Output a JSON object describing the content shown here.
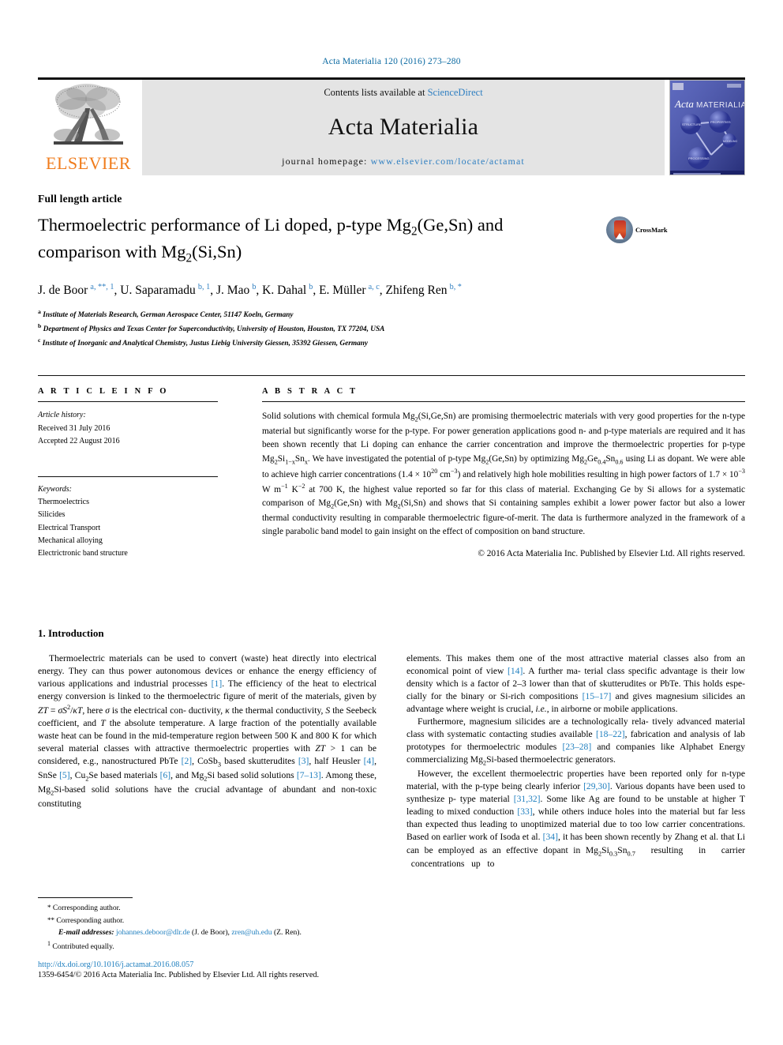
{
  "running_head": "Acta Materialia 120 (2016) 273–280",
  "masthead": {
    "publisher": "ELSEVIER",
    "contents_prefix": "Contents lists available at ",
    "contents_link": "ScienceDirect",
    "journal_name": "Acta Materialia",
    "homepage_label": "journal homepage: ",
    "homepage_url": "www.elsevier.com/locate/actamat",
    "cover_title_a": "Acta",
    "cover_title_b": "MATERIALIA",
    "cover_nodes": [
      "STRUCTURE",
      "PROPERTIES",
      "MODELING",
      "PROCESSING"
    ]
  },
  "article": {
    "type": "Full length article",
    "title_line1": "Thermoelectric performance of Li doped, p-type Mg",
    "title_sub1": "2",
    "title_line1b": "(Ge,Sn) and",
    "title_line2": "comparison with Mg",
    "title_sub2": "2",
    "title_line2b": "(Si,Sn)",
    "crossmark_label": "CrossMark"
  },
  "authors": [
    {
      "name": "J. de Boor",
      "sup": "a, **, 1"
    },
    {
      "name": "U. Saparamadu",
      "sup": "b, 1"
    },
    {
      "name": "J. Mao",
      "sup": "b"
    },
    {
      "name": "K. Dahal",
      "sup": "b"
    },
    {
      "name": "E. Müller",
      "sup": "a, c"
    },
    {
      "name": "Zhifeng Ren",
      "sup": "b, *"
    }
  ],
  "affiliations": [
    {
      "mark": "a",
      "text": "Institute of Materials Research, German Aerospace Center, 51147 Koeln, Germany"
    },
    {
      "mark": "b",
      "text": "Department of Physics and Texas Center for Superconductivity, University of Houston, Houston, TX 77204, USA"
    },
    {
      "mark": "c",
      "text": "Institute of Inorganic and Analytical Chemistry, Justus Liebig University Giessen, 35392 Giessen, Germany"
    }
  ],
  "article_info": {
    "heading": "A R T I C L E   I N F O",
    "history_label": "Article history:",
    "received": "Received 31 July 2016",
    "accepted": "Accepted 22 August 2016",
    "keywords_label": "Keywords:",
    "keywords": [
      "Thermoelectrics",
      "Silicides",
      "Electrical Transport",
      "Mechanical alloying",
      "Electrictronic band structure"
    ]
  },
  "abstract": {
    "heading": "A B S T R A C T",
    "copyright": "© 2016 Acta Materialia Inc. Published by Elsevier Ltd. All rights reserved."
  },
  "body": {
    "intro_heading": "1. Introduction"
  },
  "footnotes": {
    "corr1_mark": "*",
    "corr1": "Corresponding author.",
    "corr2_mark": "**",
    "corr2": "Corresponding author.",
    "email_label": "E-mail addresses:",
    "email1": "johannes.deboor@dlr.de",
    "email1_who": "(J. de Boor),",
    "email2": "zren@uh.edu",
    "email2_who": "(Z. Ren).",
    "contrib_mark": "1",
    "contrib": "Contributed equally."
  },
  "bottom": {
    "doi": "http://dx.doi.org/10.1016/j.actamat.2016.08.057",
    "issn": "1359-6454/© 2016 Acta Materialia Inc. Published by Elsevier Ltd. All rights reserved."
  },
  "colors": {
    "link": "#1f7fbf",
    "elsevier_orange": "#f07c1c",
    "banner_gray": "#e4e4e4"
  }
}
